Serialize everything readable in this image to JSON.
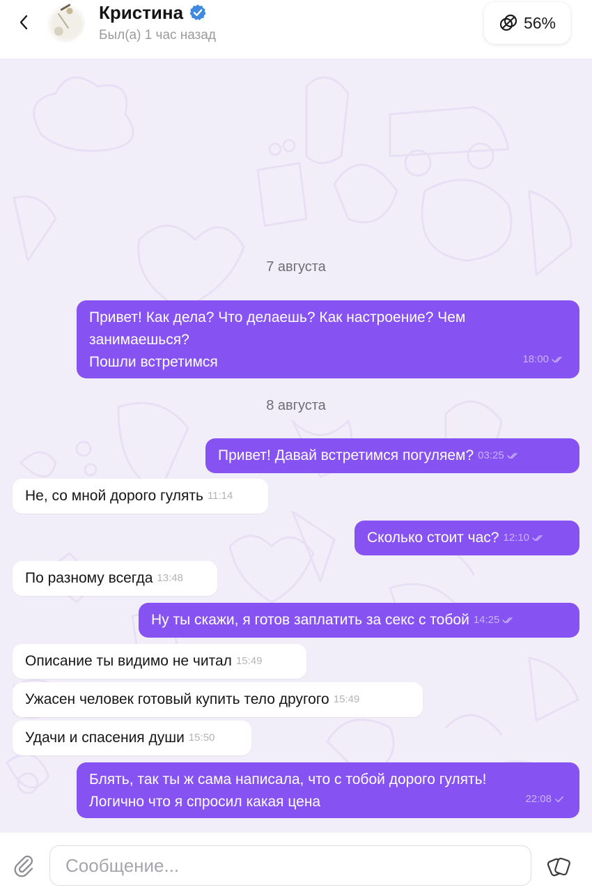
{
  "header": {
    "contact_name": "Кристина",
    "status": "Был(а) 1 час назад",
    "battery_percent": "56%"
  },
  "chat": {
    "messages": [
      {
        "type": "date",
        "text": "7 августа"
      },
      {
        "type": "outgoing",
        "text": "Привет! Как дела? Что делаешь? Как настроение? Чем\nзанимаешься?\nПошли встретимся",
        "time": "18:00",
        "ticks": "double"
      },
      {
        "type": "date",
        "text": "8 августа"
      },
      {
        "type": "outgoing",
        "text": "Привет! Давай встретимся погуляем?",
        "time": "03:25",
        "ticks": "double"
      },
      {
        "type": "incoming",
        "text": "Не, со мной дорого гулять",
        "time": "11:14"
      },
      {
        "type": "outgoing",
        "text": "Сколько стоит час?",
        "time": "12:10",
        "ticks": "double"
      },
      {
        "type": "incoming",
        "text": "По разному всегда",
        "time": "13:48"
      },
      {
        "type": "outgoing",
        "text": "Ну ты скажи, я готов заплатить за секс с тобой",
        "time": "14:25",
        "ticks": "double"
      },
      {
        "type": "incoming",
        "text": "Описание ты видимо не читал",
        "time": "15:49"
      },
      {
        "type": "incoming",
        "text": "Ужасен человек готовый купить тело другого",
        "time": "15:49"
      },
      {
        "type": "incoming",
        "text": "Удачи и спасения души",
        "time": "15:50"
      },
      {
        "type": "outgoing",
        "text": "Блять, так ты ж сама написала, что с тобой дорого гулять!\nЛогично что я спросил какая цена",
        "time": "22:08",
        "ticks": "single"
      }
    ]
  },
  "composer": {
    "placeholder": "Сообщение..."
  },
  "colors": {
    "outgoing_bubble": "#8752f2",
    "incoming_bubble": "#ffffff",
    "chat_background": "#f2eef9",
    "verified_badge": "#3f8ae0"
  },
  "icons": {
    "back": "chevron-left-icon",
    "verified": "verified-badge-icon",
    "battery": "linked-circles-icon",
    "attach": "paperclip-icon",
    "sticker": "sticker-icon",
    "ticks": "double-check-icon"
  }
}
